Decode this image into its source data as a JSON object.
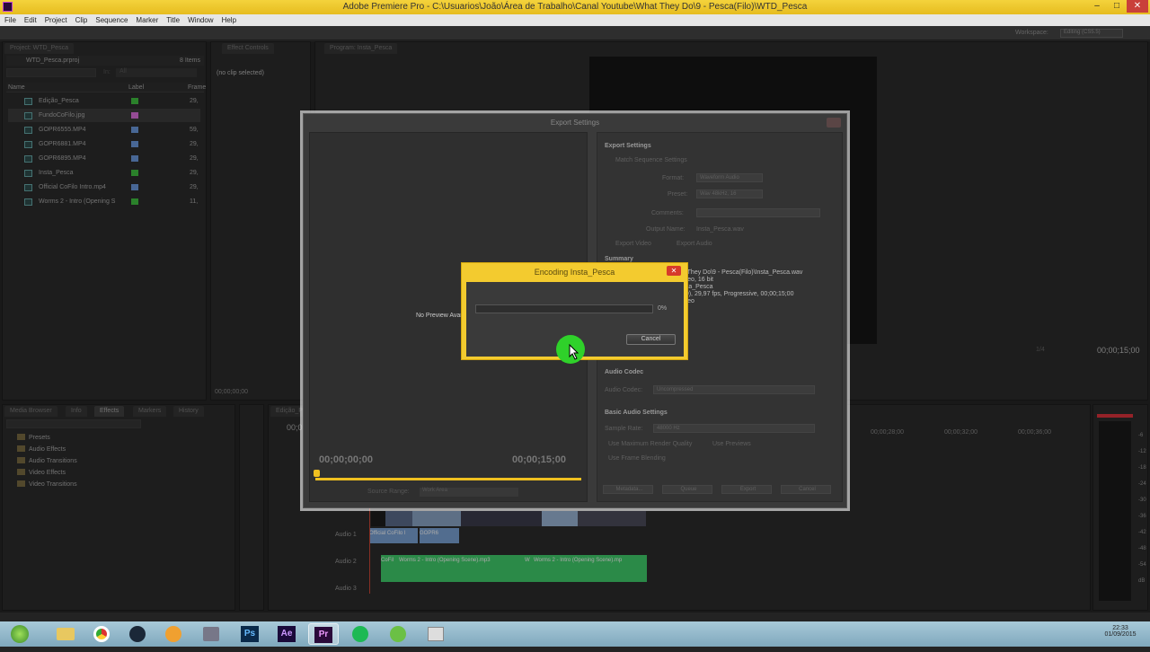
{
  "window": {
    "title": "Adobe Premiere Pro - C:\\Usuarios\\João\\Área de Trabalho\\Canal Youtube\\What They Do\\9 - Pesca(Filo)\\WTD_Pesca",
    "minimize": "–",
    "maximize": "□",
    "close": "✕"
  },
  "menu": [
    "File",
    "Edit",
    "Project",
    "Clip",
    "Sequence",
    "Marker",
    "Title",
    "Window",
    "Help"
  ],
  "workspace": {
    "label": "Workspace:",
    "value": "Editing (CS5.5)"
  },
  "project": {
    "tab": "Project: WTD_Pesca",
    "file": "WTD_Pesca.prproj",
    "count": "8 Items",
    "in_label": "In:",
    "in_value": "All",
    "columns": {
      "name": "Name",
      "label": "Label",
      "frame": "Frame"
    },
    "items": [
      {
        "name": "Edição_Pesca",
        "color": "#3ec23e",
        "frame": "29,"
      },
      {
        "name": "FundoCoFilo.jpg",
        "color": "#e070e0",
        "frame": ""
      },
      {
        "name": "GOPR6555.MP4",
        "color": "#6a9ae0",
        "frame": "59,"
      },
      {
        "name": "GOPR6881.MP4",
        "color": "#6a9ae0",
        "frame": "29,"
      },
      {
        "name": "GOPR6895.MP4",
        "color": "#6a9ae0",
        "frame": "29,"
      },
      {
        "name": "Insta_Pesca",
        "color": "#3ec23e",
        "frame": "29,"
      },
      {
        "name": "Official CoFilo Intro.mp4",
        "color": "#6a9ae0",
        "frame": "29,"
      },
      {
        "name": "Worms 2 - Intro (Opening S",
        "color": "#3ec23e",
        "frame": "11,"
      }
    ]
  },
  "source": {
    "tab": "Effect Controls",
    "no_clip": "(no clip selected)",
    "timecode": "00;00;00;00"
  },
  "program": {
    "tab": "Program: Insta_Pesca",
    "zoom": "1/4",
    "timecode": "00;00;15;00"
  },
  "effects": {
    "tabs": [
      "Media Browser",
      "Info",
      "Effects",
      "Markers",
      "History"
    ],
    "folders": [
      "Presets",
      "Audio Effects",
      "Audio Transitions",
      "Video Effects",
      "Video Transitions"
    ]
  },
  "timeline": {
    "tab": "Edição_Pesca",
    "timecode_left": "00;0",
    "ruler": [
      "00;00;28;00",
      "00;00;32;00",
      "00;00;36;00"
    ],
    "tracks": [
      "Audio 1",
      "Audio 2",
      "Audio 3"
    ],
    "audio1_clips": [
      "Official CoFilo I",
      "GOPR6"
    ],
    "audio2_clips": [
      "CoFil",
      "Worms 2 - Intro (Opening Scene).mp3",
      "W",
      "Worms 2 - Intro (Opening Scene).mp"
    ]
  },
  "meters": [
    "-6",
    "-12",
    "-18",
    "-24",
    "-30",
    "-36",
    "-42",
    "-48",
    "-54",
    "dB"
  ],
  "export": {
    "title": "Export Settings",
    "no_preview": "No Preview Available",
    "tc_start": "00;00;00;00",
    "tc_end": "00;00;15;00",
    "source_range_label": "Source Range:",
    "source_range": "Work Area",
    "export_settings_header": "Export Settings",
    "match_seq": "Match Sequence Settings",
    "format_label": "Format:",
    "format": "Waveform Audio",
    "preset_label": "Preset:",
    "preset": "Wav 48kHz, 16",
    "comments_label": "Comments:",
    "output_label": "Output Name:",
    "output": "Insta_Pesca.wav",
    "export_video": "Export Video",
    "export_audio": "Export Audio",
    "summary_header": "Summary",
    "summary_lines": [
      "at They Do\\9 - Pesca(Filo)\\Insta_Pesca.wav",
      "tereo, 16 bit",
      "nsta_Pesca",
      "1,0), 29,97 fps, Progressive, 00;00;15;00",
      "tereo"
    ],
    "audio_codec_header": "Audio Codec",
    "audio_codec_label": "Audio Codec:",
    "audio_codec": "Uncompressed",
    "basic_audio_header": "Basic Audio Settings",
    "sample_rate_label": "Sample Rate:",
    "sample_rate": "48000 Hz",
    "max_render": "Use Maximum Render Quality",
    "use_previews": "Use Previews",
    "frame_blending": "Use Frame Blending",
    "buttons": [
      "Metadata...",
      "Queue",
      "Export",
      "Cancel"
    ]
  },
  "encoding": {
    "title": "Encoding Insta_Pesca",
    "progress_percent": 0,
    "percent_text": "0%",
    "cancel": "Cancel",
    "close": "✕"
  },
  "taskbar": {
    "apps": [
      "start-orb",
      "file-explorer",
      "chrome",
      "steam",
      "media-player",
      "game-tool",
      "Ps",
      "Ae",
      "Pr",
      "spotify",
      "utorrent",
      "app-grid"
    ],
    "clock_time": "22:33",
    "clock_date": "01/09/2015"
  }
}
